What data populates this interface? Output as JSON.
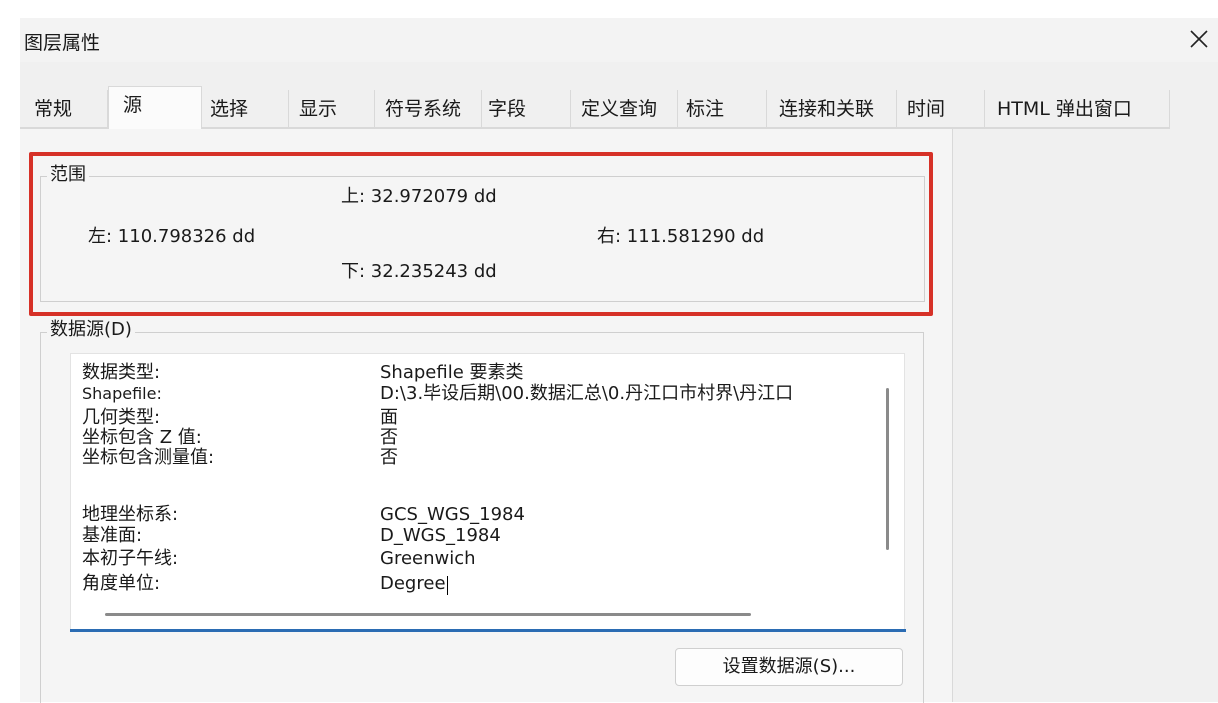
{
  "window": {
    "title": "图层属性"
  },
  "tabs": [
    {
      "label": "常规"
    },
    {
      "label": "源"
    },
    {
      "label": "选择"
    },
    {
      "label": "显示"
    },
    {
      "label": "符号系统"
    },
    {
      "label": "字段"
    },
    {
      "label": "定义查询"
    },
    {
      "label": "标注"
    },
    {
      "label": "连接和关联"
    },
    {
      "label": "时间"
    },
    {
      "label": "HTML 弹出窗口"
    }
  ],
  "active_tab": "源",
  "extent": {
    "title": "范围",
    "top": "上:  32.972079 dd",
    "left": "左: 110.798326 dd",
    "right": "右:  111.581290 dd",
    "bottom": "下:  32.235243 dd"
  },
  "data_source": {
    "title": "数据源(D)",
    "rows": [
      {
        "label": "数据类型:",
        "value": "Shapefile 要素类"
      },
      {
        "label": "Shapefile:",
        "value": "D:\\3.毕设后期\\00.数据汇总\\0.丹江口市村界\\丹江口"
      },
      {
        "label": "几何类型:",
        "value": "面"
      },
      {
        "label": "坐标包含 Z 值:",
        "value": "否"
      },
      {
        "label": "坐标包含测量值:",
        "value": "否"
      },
      {
        "label": "地理坐标系:",
        "value": "GCS_WGS_1984"
      },
      {
        "label": "基准面:",
        "value": "D_WGS_1984"
      },
      {
        "label": "本初子午线:",
        "value": "Greenwich"
      },
      {
        "label": "角度单位:",
        "value": "Degree"
      }
    ],
    "button_label": "设置数据源(S)..."
  },
  "icons": {
    "close": "close-icon"
  },
  "colors": {
    "highlight": "#d63127",
    "accent_underline": "#2b6cb3"
  }
}
